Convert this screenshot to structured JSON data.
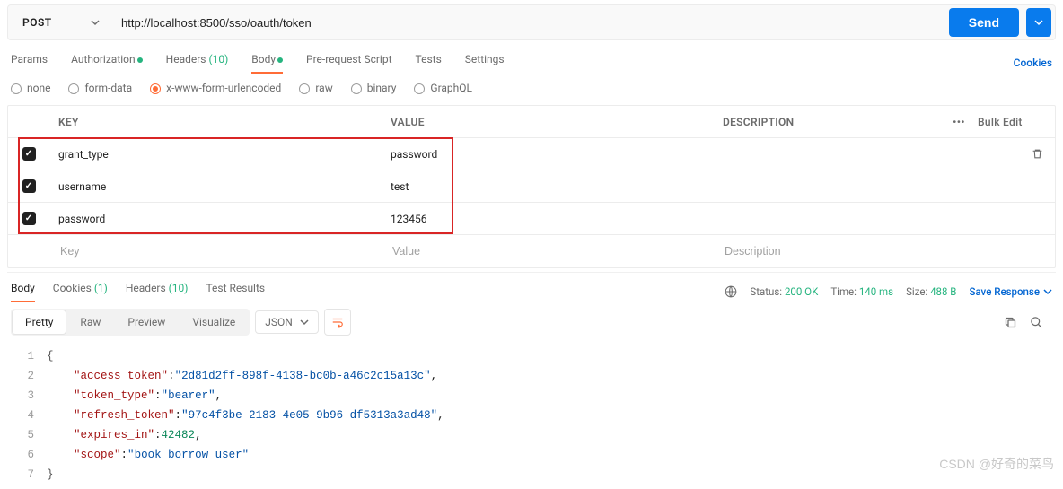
{
  "request": {
    "method": "POST",
    "url": "http://localhost:8500/sso/oauth/token",
    "send_label": "Send"
  },
  "tabs": {
    "params": "Params",
    "auth": "Authorization",
    "headers": "Headers",
    "headers_count": "(10)",
    "body": "Body",
    "prereq": "Pre-request Script",
    "tests": "Tests",
    "settings": "Settings",
    "cookies_link": "Cookies"
  },
  "body_types": {
    "none": "none",
    "formdata": "form-data",
    "urlencoded": "x-www-form-urlencoded",
    "raw": "raw",
    "binary": "binary",
    "graphql": "GraphQL"
  },
  "table": {
    "headers": {
      "key": "KEY",
      "value": "VALUE",
      "desc": "DESCRIPTION",
      "bulk": "Bulk Edit"
    },
    "rows": [
      {
        "key": "grant_type",
        "value": "password"
      },
      {
        "key": "username",
        "value": "test"
      },
      {
        "key": "password",
        "value": "123456"
      }
    ],
    "placeholders": {
      "key": "Key",
      "value": "Value",
      "desc": "Description"
    }
  },
  "response": {
    "tabs": {
      "body": "Body",
      "cookies": "Cookies",
      "cookies_count": "(1)",
      "headers": "Headers",
      "headers_count": "(10)",
      "tests": "Test Results"
    },
    "status_label": "Status:",
    "status_value": "200 OK",
    "time_label": "Time:",
    "time_value": "140 ms",
    "size_label": "Size:",
    "size_value": "488 B",
    "save": "Save Response",
    "views": {
      "pretty": "Pretty",
      "raw": "Raw",
      "preview": "Preview",
      "visualize": "Visualize"
    },
    "format": "JSON"
  },
  "json_body": {
    "access_token": "2d81d2ff-898f-4138-bc0b-a46c2c15a13c",
    "token_type": "bearer",
    "refresh_token": "97c4f3be-2183-4e05-9b96-df5313a3ad48",
    "expires_in": 42482,
    "scope": "book borrow user"
  },
  "watermark": "CSDN @好奇的菜鸟"
}
